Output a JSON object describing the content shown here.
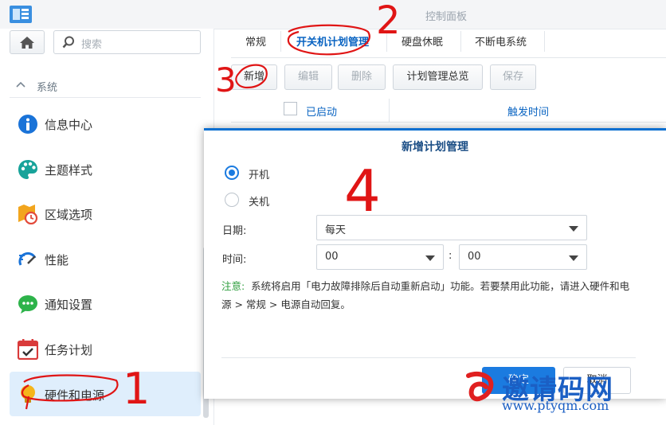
{
  "window": {
    "title": "控制面板"
  },
  "sidebar": {
    "search_placeholder": "搜索",
    "section_label": "系统",
    "items": [
      {
        "label": "信息中心",
        "icon": "info-icon"
      },
      {
        "label": "主题样式",
        "icon": "palette-icon"
      },
      {
        "label": "区域选项",
        "icon": "region-clock-icon"
      },
      {
        "label": "性能",
        "icon": "performance-icon"
      },
      {
        "label": "通知设置",
        "icon": "chat-bubble-icon"
      },
      {
        "label": "任务计划",
        "icon": "calendar-check-icon"
      },
      {
        "label": "硬件和电源",
        "icon": "bulb-icon",
        "active": true
      }
    ]
  },
  "tabs": [
    {
      "label": "常规"
    },
    {
      "label": "开关机计划管理",
      "active": true
    },
    {
      "label": "硬盘休眠"
    },
    {
      "label": "不断电系统"
    }
  ],
  "toolbar": {
    "add": "新增",
    "edit": "编辑",
    "delete": "删除",
    "overview": "计划管理总览",
    "save": "保存"
  },
  "grid": {
    "col_enabled": "已启动",
    "col_trigger": "触发时间"
  },
  "dialog": {
    "title": "新增计划管理",
    "radio_on": "开机",
    "radio_off": "关机",
    "selected": "开机",
    "date_label": "日期:",
    "date_value": "每天",
    "time_label": "时间:",
    "hour_value": "00",
    "minute_value": "00",
    "time_sep": ":",
    "note_label": "注意:",
    "note_text": "系统将启用「电力故障排除后自动重新启动」功能。若要禁用此功能，请进入硬件和电源 > 常规 > 电源自动回复。",
    "ok": "确定",
    "cancel": "取消"
  },
  "annotations": {
    "n1": "1",
    "n2": "2",
    "n3": "3",
    "n4": "4"
  },
  "watermark": {
    "text": "邀请码网",
    "url": "www.ptyqm.com"
  },
  "colors": {
    "accent": "#1b7be0",
    "annotation": "#e01515",
    "active_bg": "#dfeefc"
  }
}
